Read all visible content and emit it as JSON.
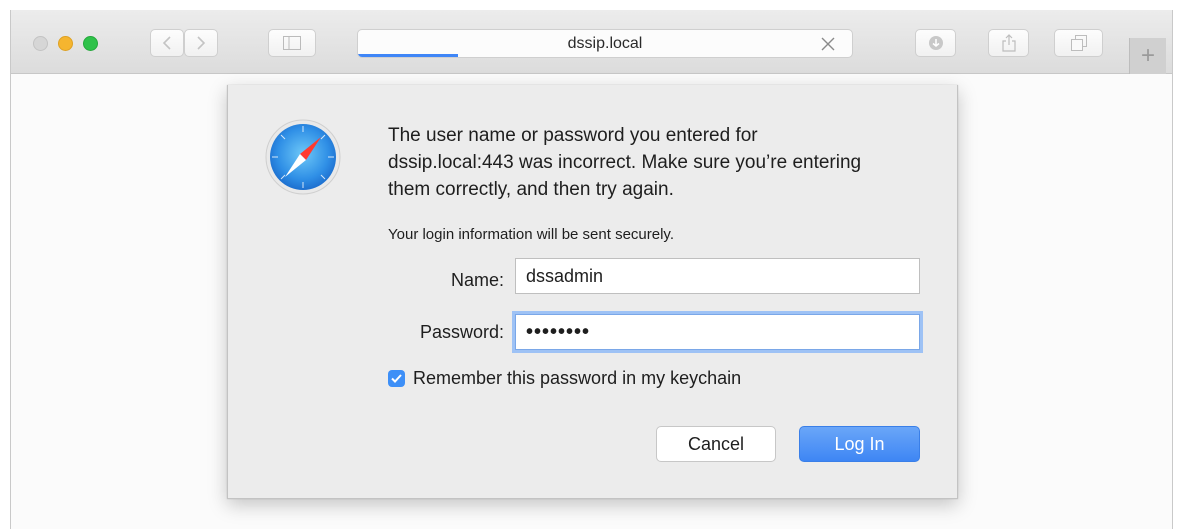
{
  "browser": {
    "address": "dssip.local",
    "new_tab": "+"
  },
  "dialog": {
    "message": "The user name or password you entered for dssip.local:443 was incorrect. Make sure you’re entering them correctly, and then try again.",
    "secure_note": "Your login information will be sent securely.",
    "name_label": "Name:",
    "name_value": "dssadmin",
    "password_label": "Password:",
    "password_value": "••••••••",
    "remember_label": "Remember this password in my keychain",
    "remember_checked": true,
    "cancel_label": "Cancel",
    "login_label": "Log In"
  },
  "colors": {
    "accent": "#3e86f4",
    "close": "#d0d0d0",
    "minimize": "#f5b52f",
    "zoom": "#2fc24a"
  }
}
